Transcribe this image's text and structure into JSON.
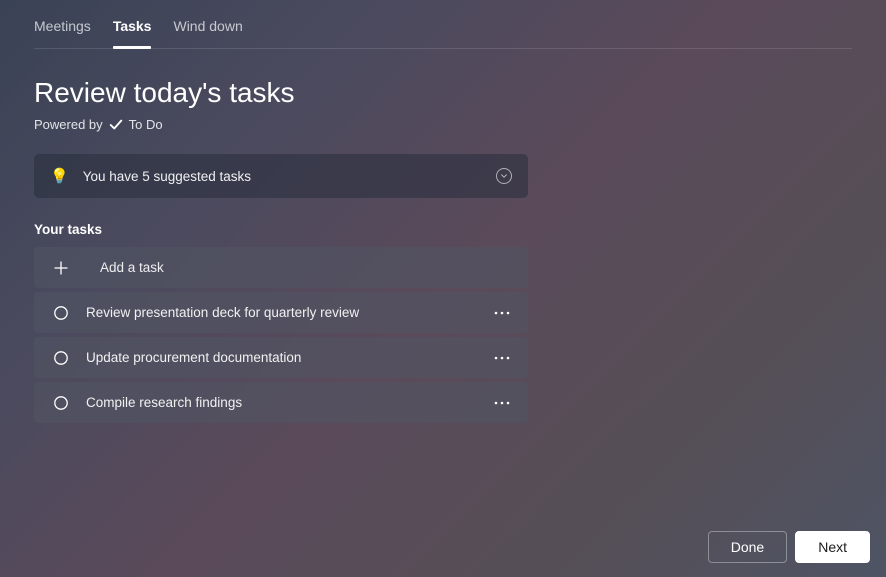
{
  "tabs": [
    {
      "label": "Meetings",
      "active": false
    },
    {
      "label": "Tasks",
      "active": true
    },
    {
      "label": "Wind down",
      "active": false
    }
  ],
  "page": {
    "title": "Review today's tasks",
    "powered_prefix": "Powered by",
    "powered_app": "To Do"
  },
  "suggested": {
    "text": "You have 5 suggested tasks"
  },
  "your_tasks_label": "Your tasks",
  "add_task_label": "Add a task",
  "tasks": [
    {
      "title": "Review presentation deck for quarterly review"
    },
    {
      "title": "Update procurement documentation"
    },
    {
      "title": "Compile research findings"
    }
  ],
  "footer": {
    "done": "Done",
    "next": "Next"
  }
}
